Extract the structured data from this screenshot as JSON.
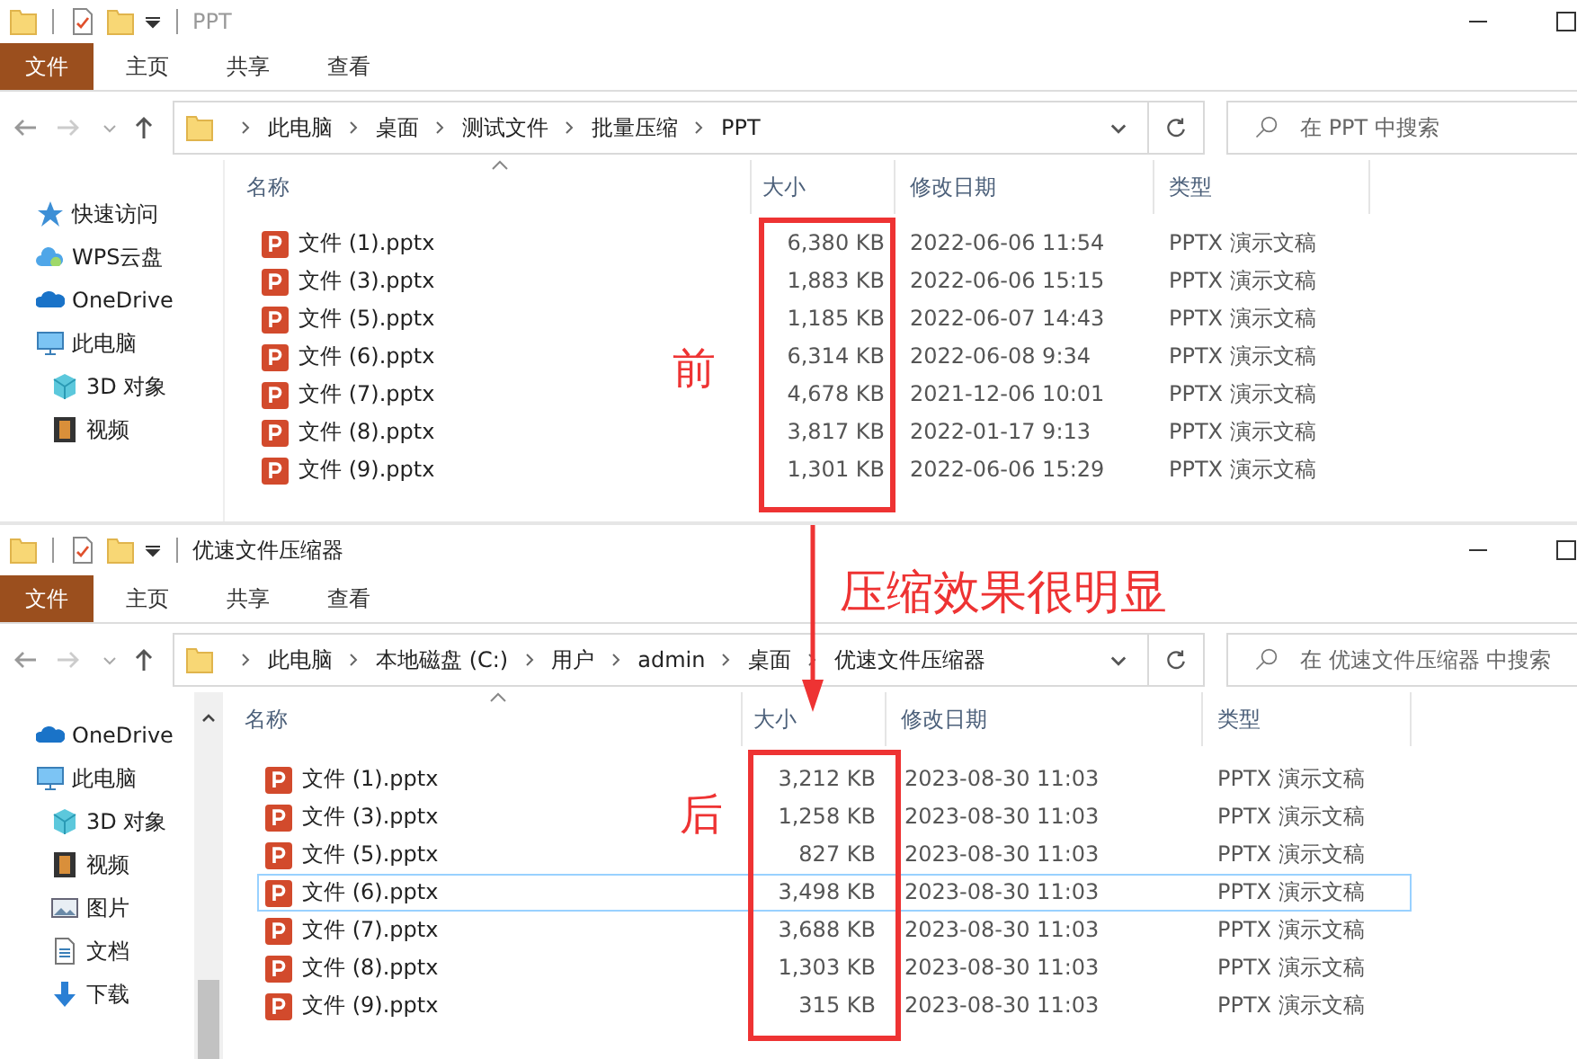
{
  "windows": [
    {
      "title": "PPT",
      "active": false,
      "menu_tabs": [
        {
          "label": "文件",
          "selected": true
        },
        {
          "label": "主页",
          "selected": false
        },
        {
          "label": "共享",
          "selected": false
        },
        {
          "label": "查看",
          "selected": false
        }
      ],
      "breadcrumbs": [
        "此电脑",
        "桌面",
        "测试文件",
        "批量压缩",
        "PPT"
      ],
      "search": {
        "placeholder": "在 PPT 中搜索"
      },
      "sidebar_scrollbar": false,
      "sidebar": [
        {
          "label": "快速访问",
          "kind": "star"
        },
        {
          "label": "WPS云盘",
          "kind": "cloud"
        },
        {
          "label": "OneDrive",
          "kind": "onedrive"
        },
        {
          "label": "此电脑",
          "kind": "pc",
          "children": [
            {
              "label": "3D 对象",
              "kind": "cube"
            },
            {
              "label": "视频",
              "kind": "video"
            }
          ]
        }
      ],
      "columns": [
        "名称",
        "大小",
        "修改日期",
        "类型"
      ],
      "rows": [
        {
          "name": "文件 (1).pptx",
          "size": "6,380 KB",
          "modified": "2022-06-06 11:54",
          "type": "PPTX 演示文稿",
          "selected": false
        },
        {
          "name": "文件 (3).pptx",
          "size": "1,883 KB",
          "modified": "2022-06-06 15:15",
          "type": "PPTX 演示文稿",
          "selected": false
        },
        {
          "name": "文件 (5).pptx",
          "size": "1,185 KB",
          "modified": "2022-06-07 14:43",
          "type": "PPTX 演示文稿",
          "selected": false
        },
        {
          "name": "文件 (6).pptx",
          "size": "6,314 KB",
          "modified": "2022-06-08 9:34",
          "type": "PPTX 演示文稿",
          "selected": false
        },
        {
          "name": "文件 (7).pptx",
          "size": "4,678 KB",
          "modified": "2021-12-06 10:01",
          "type": "PPTX 演示文稿",
          "selected": false
        },
        {
          "name": "文件 (8).pptx",
          "size": "3,817 KB",
          "modified": "2022-01-17 9:13",
          "type": "PPTX 演示文稿",
          "selected": false
        },
        {
          "name": "文件 (9).pptx",
          "size": "1,301 KB",
          "modified": "2022-06-06 15:29",
          "type": "PPTX 演示文稿",
          "selected": false
        }
      ],
      "annotation": "前"
    },
    {
      "title": "优速文件压缩器",
      "active": true,
      "menu_tabs": [
        {
          "label": "文件",
          "selected": true
        },
        {
          "label": "主页",
          "selected": false
        },
        {
          "label": "共享",
          "selected": false
        },
        {
          "label": "查看",
          "selected": false
        }
      ],
      "breadcrumbs": [
        "此电脑",
        "本地磁盘 (C:)",
        "用户",
        "admin",
        "桌面",
        "优速文件压缩器"
      ],
      "search": {
        "placeholder": "在 优速文件压缩器 中搜索"
      },
      "sidebar_scrollbar": true,
      "sidebar": [
        {
          "label": "OneDrive",
          "kind": "onedrive"
        },
        {
          "label": "此电脑",
          "kind": "pc",
          "children": [
            {
              "label": "3D 对象",
              "kind": "cube"
            },
            {
              "label": "视频",
              "kind": "video"
            },
            {
              "label": "图片",
              "kind": "picture"
            },
            {
              "label": "文档",
              "kind": "doc"
            },
            {
              "label": "下载",
              "kind": "download"
            }
          ]
        }
      ],
      "columns": [
        "名称",
        "大小",
        "修改日期",
        "类型"
      ],
      "rows": [
        {
          "name": "文件 (1).pptx",
          "size": "3,212 KB",
          "modified": "2023-08-30 11:03",
          "type": "PPTX 演示文稿",
          "selected": false
        },
        {
          "name": "文件 (3).pptx",
          "size": "1,258 KB",
          "modified": "2023-08-30 11:03",
          "type": "PPTX 演示文稿",
          "selected": false
        },
        {
          "name": "文件 (5).pptx",
          "size": "827 KB",
          "modified": "2023-08-30 11:03",
          "type": "PPTX 演示文稿",
          "selected": false
        },
        {
          "name": "文件 (6).pptx",
          "size": "3,498 KB",
          "modified": "2023-08-30 11:03",
          "type": "PPTX 演示文稿",
          "selected": true
        },
        {
          "name": "文件 (7).pptx",
          "size": "3,688 KB",
          "modified": "2023-08-30 11:03",
          "type": "PPTX 演示文稿",
          "selected": false
        },
        {
          "name": "文件 (8).pptx",
          "size": "1,303 KB",
          "modified": "2023-08-30 11:03",
          "type": "PPTX 演示文稿",
          "selected": false
        },
        {
          "name": "文件 (9).pptx",
          "size": "315 KB",
          "modified": "2023-08-30 11:03",
          "type": "PPTX 演示文稿",
          "selected": false
        }
      ],
      "annotation": "后"
    }
  ],
  "caption": "压缩效果很明显"
}
